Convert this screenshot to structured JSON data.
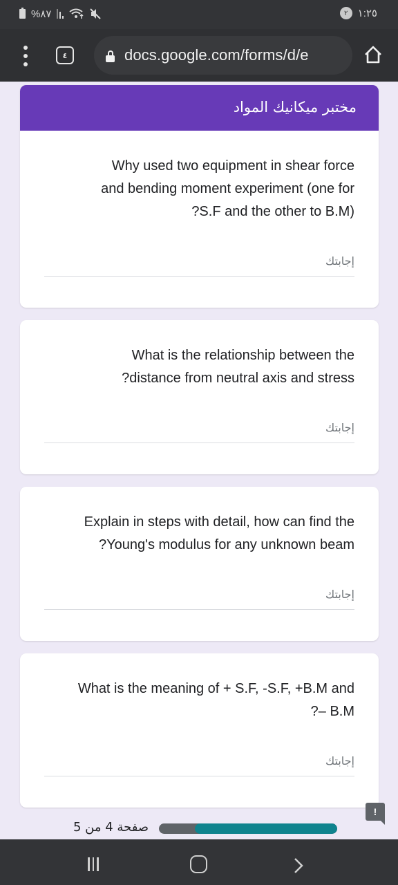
{
  "status_bar": {
    "battery_percent": "%٨٧",
    "notification_count": "٢",
    "time": "١:٢٥"
  },
  "browser": {
    "tab_count": "٤",
    "url": "docs.google.com/forms/d/e"
  },
  "form": {
    "title": "مختبر ميكانيك المواد",
    "accent_color": "#673ab7",
    "questions": [
      {
        "text": "Why used two equipment in shear force\nand bending moment experiment (one for\n?S.F and the other to B.M)",
        "answer_placeholder": "إجابتك",
        "answer_value": ""
      },
      {
        "text": "What is the relationship between the\n?distance from neutral axis and stress",
        "answer_placeholder": "إجابتك",
        "answer_value": ""
      },
      {
        "text": "Explain in steps with detail, how can find the\n?Young's modulus for any unknown beam",
        "answer_placeholder": "إجابتك",
        "answer_value": ""
      },
      {
        "text": "What is the meaning of + S.F, -S.F, +B.M and\n?– B.M",
        "answer_placeholder": "إجابتك",
        "answer_value": ""
      }
    ]
  },
  "footer": {
    "page_indicator": "صفحة 4 من 5",
    "current_page": 4,
    "total_pages": 5,
    "progress_fraction": 0.8,
    "progress_color": "#0f838e",
    "feedback_label": "!"
  }
}
